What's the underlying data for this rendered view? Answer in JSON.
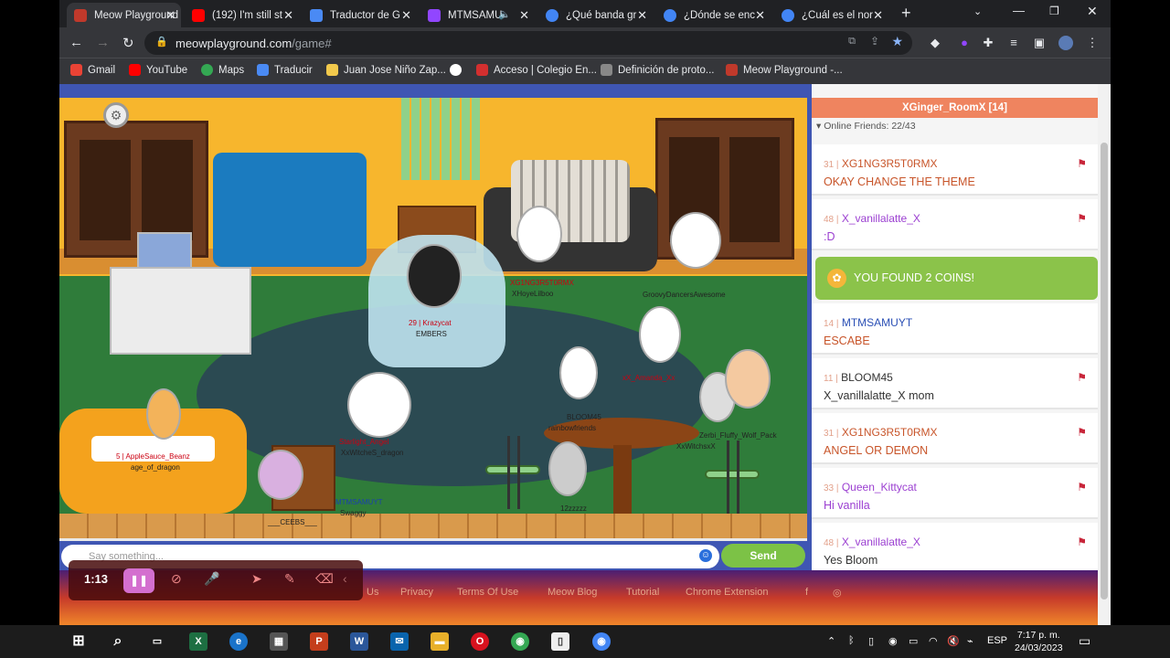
{
  "browser": {
    "tabs": [
      {
        "title": "Meow Playground",
        "color": "#c0392b",
        "active": true
      },
      {
        "title": "(192) I'm still st",
        "color": "#ff0000"
      },
      {
        "title": "Traductor de G",
        "color": "#4a8af4"
      },
      {
        "title": "MTMSAMU",
        "color": "#9146ff"
      },
      {
        "title": "¿Qué banda gr",
        "color": "#4285f4"
      },
      {
        "title": "¿Dónde se enc",
        "color": "#4285f4"
      },
      {
        "title": "¿Cuál es el nor",
        "color": "#4285f4"
      }
    ],
    "url_host": "meowplayground.com",
    "url_path": "/game#",
    "bookmarks": [
      "Gmail",
      "YouTube",
      "Maps",
      "Traducir",
      "Juan Jose Niño Zap...",
      "",
      "Acceso | Colegio En...",
      "Definición de proto...",
      "Meow Playground -..."
    ]
  },
  "game": {
    "players": [
      {
        "name": "XG1NG3R5T0RMX",
        "red": true
      },
      {
        "name": "XHoyeLilboo",
        "red": false
      },
      {
        "name": "GroovyDancersAwesome",
        "red": false
      },
      {
        "name": "29 | Krazycat",
        "red": true
      },
      {
        "name": "EMBERS",
        "red": false
      },
      {
        "name": "xX_Amanda_Xx",
        "red": true
      },
      {
        "name": "BLOOM45",
        "red": false
      },
      {
        "name": "rainbowfriends",
        "red": false
      },
      {
        "name": "Zerbi_Fluffy_Wolf_Pack",
        "red": false
      },
      {
        "name": "XxWitchsxX",
        "red": false
      },
      {
        "name": "5 | AppleSauce_Beanz",
        "red": true
      },
      {
        "name": "age_of_dragon",
        "red": false
      },
      {
        "name": "Starlight_Angel",
        "red": true
      },
      {
        "name": "XxWitcheS_dragon",
        "red": false
      },
      {
        "name": "MTMSAMUYT",
        "red": false
      },
      {
        "name": "Swaggy",
        "red": false
      },
      {
        "name": "12zzzzz",
        "red": false
      },
      {
        "name": "___CEEBS___",
        "red": false
      }
    ]
  },
  "chat_input": {
    "placeholder": "Say something...",
    "send_label": "Send"
  },
  "panel": {
    "room_title": "XGinger_RoomX [14]",
    "online_friends": "Online Friends: 22/43",
    "messages": [
      {
        "level": "31 |",
        "user": "XG1NG3R5T0RMX",
        "text": "OKAY CHANGE THE THEME",
        "user_color": "#c8552a",
        "text_color": "#c8552a",
        "flag": true
      },
      {
        "level": "48 |",
        "user": "X_vanillalatte_X",
        "text": ":D",
        "user_color": "#9b3fd1",
        "text_color": "#9b3fd1",
        "flag": true
      },
      {
        "level": "14 |",
        "user": "MTMSAMUYT",
        "text": "ESCABE",
        "user_color": "#2a4fb5",
        "text_color": "#c8552a",
        "flag": false
      },
      {
        "level": "11 |",
        "user": "BLOOM45",
        "text": "X_vanillalatte_X mom",
        "user_color": "#333333",
        "text_color": "#333333",
        "flag": true
      },
      {
        "level": "31 |",
        "user": "XG1NG3R5T0RMX",
        "text": "ANGEL OR DEMON",
        "user_color": "#c8552a",
        "text_color": "#c8552a",
        "flag": true
      },
      {
        "level": "33 |",
        "user": "Queen_Kittycat",
        "text": "Hi vanilla",
        "user_color": "#9b3fd1",
        "text_color": "#9b3fd1",
        "flag": true
      },
      {
        "level": "48 |",
        "user": "X_vanillalatte_X",
        "text": "Yes Bloom",
        "user_color": "#9b3fd1",
        "text_color": "#333333",
        "flag": true
      }
    ],
    "coin_notice": "YOU FOUND 2 COINS!"
  },
  "footer_links": [
    "Us",
    "Privacy",
    "Terms Of Use",
    "Meow Blog",
    "Tutorial",
    "Chrome Extension"
  ],
  "recorder": {
    "time": "1:13"
  },
  "taskbar": {
    "lang": "ESP",
    "time": "7:17 p. m.",
    "date": "24/03/2023"
  }
}
